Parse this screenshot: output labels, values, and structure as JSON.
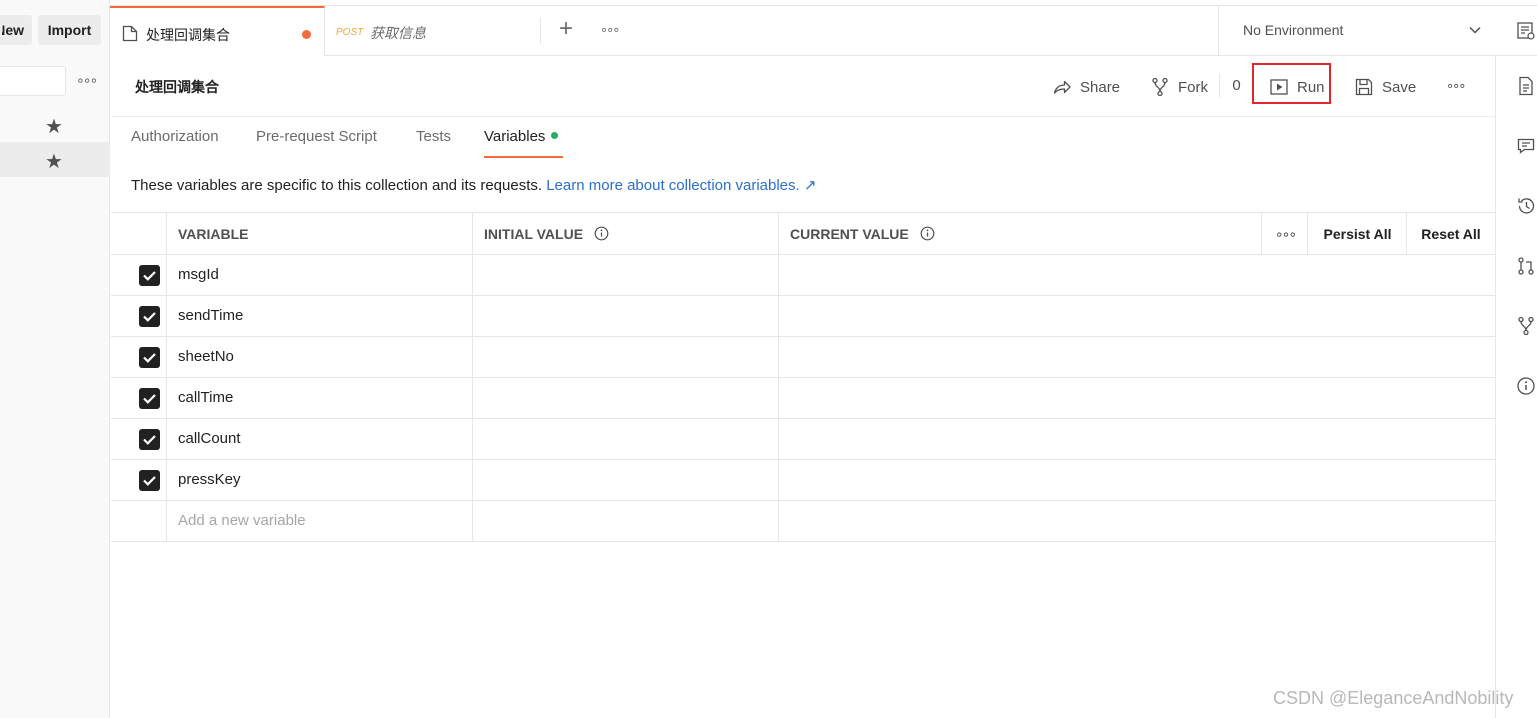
{
  "sidebar": {
    "new_label": "New",
    "import_label": "Import",
    "more_icon": "more-horizontal-icon",
    "rows": [
      {
        "icon": "star-icon",
        "selected": false
      },
      {
        "icon": "star-icon",
        "selected": true
      }
    ]
  },
  "tabs": [
    {
      "title": "处理回调集合",
      "icon": "document-icon",
      "unsaved": true,
      "active": true
    },
    {
      "method": "POST",
      "title": "获取信息",
      "active": false
    }
  ],
  "environment": {
    "label": "No Environment"
  },
  "collection": {
    "title": "处理回调集合",
    "actions": {
      "share": "Share",
      "fork": "Fork",
      "fork_count": "0",
      "run": "Run",
      "save": "Save"
    }
  },
  "subtabs": [
    "Authorization",
    "Pre-request Script",
    "Tests",
    "Variables"
  ],
  "active_subtab": "Variables",
  "description": {
    "text": "These variables are specific to this collection and its requests.",
    "link": "Learn more about collection variables. ↗"
  },
  "table": {
    "headers": {
      "variable": "VARIABLE",
      "initial": "INITIAL VALUE",
      "current": "CURRENT VALUE",
      "persist_all": "Persist All",
      "reset_all": "Reset All"
    },
    "rows": [
      {
        "name": "msgId",
        "checked": true,
        "initial": "",
        "current": ""
      },
      {
        "name": "sendTime",
        "checked": true,
        "initial": "",
        "current": ""
      },
      {
        "name": "sheetNo",
        "checked": true,
        "initial": "",
        "current": ""
      },
      {
        "name": "callTime",
        "checked": true,
        "initial": "",
        "current": ""
      },
      {
        "name": "callCount",
        "checked": true,
        "initial": "",
        "current": ""
      },
      {
        "name": "pressKey",
        "checked": true,
        "initial": "",
        "current": ""
      }
    ],
    "add_placeholder": "Add a new variable"
  },
  "right_sidebar_icons": [
    "documentation-icon",
    "comments-icon",
    "history-icon",
    "pull-request-icon",
    "fork-icon",
    "info-icon"
  ],
  "watermark": "CSDN @EleganceAndNobility",
  "colors": {
    "accent": "#f26b3a",
    "link": "#2b6fcf",
    "highlight_box": "#e4262b",
    "variables_dot": "#27ae60"
  }
}
